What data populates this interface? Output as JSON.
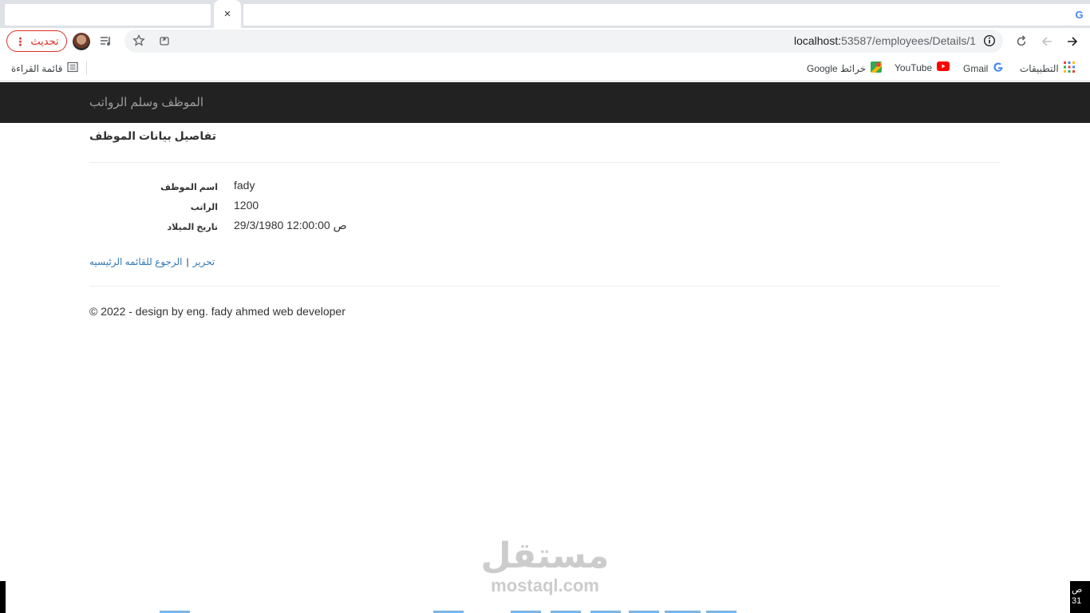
{
  "browser": {
    "active_tab_close": "×",
    "google_corner": "G",
    "update_button": "تحديث",
    "update_dots": "⋮",
    "url_host": "localhost:",
    "url_path": "53587/employees/Details/1",
    "bookmarks": {
      "reading_list": "قائمة القراءة",
      "apps": "التطبيقات",
      "gmail": "Gmail",
      "youtube": "YouTube",
      "maps": "خرائط Google"
    }
  },
  "navbar": {
    "brand": "الموظف وسلم الرواتب"
  },
  "page": {
    "title": "تفاصيل بيانات الموظف",
    "fields": [
      {
        "label": "اسم الموظف",
        "value": "fady"
      },
      {
        "label": "الراتب",
        "value": "1200"
      },
      {
        "label": "تاريخ الميلاد",
        "value": "29/3/1980 12:00:00 ص"
      }
    ],
    "links": {
      "edit": "تحرير",
      "separator": "|",
      "back": "الرجوع للقائمه الرئيسيه"
    },
    "footer": "© 2022 - design by eng. fady ahmed web developer"
  },
  "watermark": {
    "arabic": "مستقل",
    "latin": "mostaql.com"
  },
  "taskbar": {
    "clock_line1": "ص",
    "clock_line2": "31"
  },
  "colors": {
    "navbar": "#222222",
    "link": "#337ab7",
    "update_red": "#d93025"
  }
}
